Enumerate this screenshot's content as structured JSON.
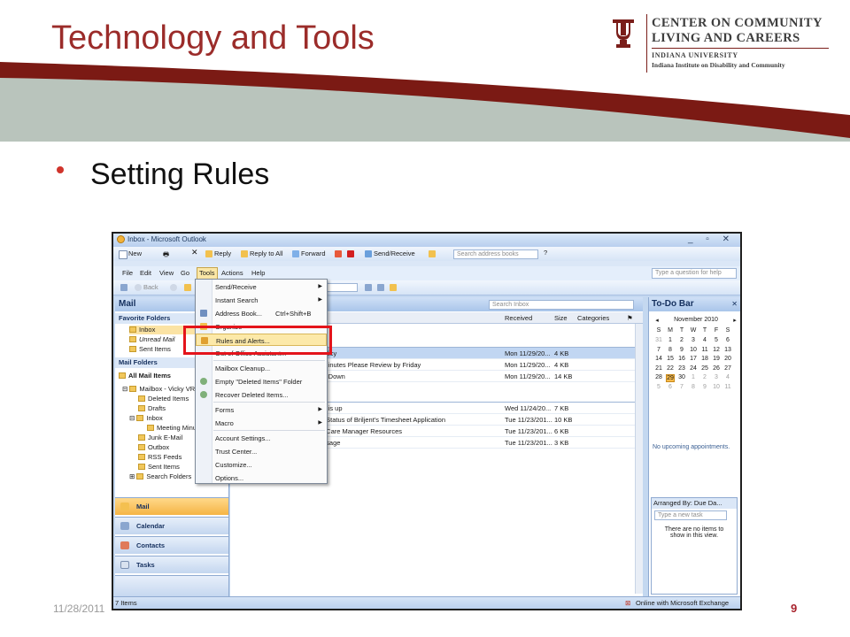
{
  "slide": {
    "title": "Technology and Tools",
    "bullet": "Setting Rules",
    "date": "11/28/2011",
    "page": "9"
  },
  "brand": {
    "line1": "CENTER ON COMMUNITY",
    "line2": "LIVING AND CAREERS",
    "line3": "INDIANA UNIVERSITY",
    "line4": "Indiana Institute on Disability and Community"
  },
  "colors": {
    "brand_red": "#7a1e1a",
    "title_red": "#9b2c2a",
    "swoosh_gray": "#b9c4bc",
    "highlight": "#e4141b"
  },
  "outlook": {
    "title": "Inbox - Microsoft Outlook",
    "toolbar1": {
      "new": "New",
      "reply": "Reply",
      "reply_all": "Reply to All",
      "forward": "Forward",
      "send_receive": "Send/Receive",
      "search_placeholder": "Search address books"
    },
    "menubar": [
      "File",
      "Edit",
      "View",
      "Go",
      "Tools",
      "Actions",
      "Help"
    ],
    "help_placeholder": "Type a question for help",
    "toolbar2": {
      "back": "Back"
    },
    "nav": {
      "header": "Mail",
      "favorites_header": "Favorite Folders",
      "favorites": [
        "Inbox",
        "Unread Mail",
        "Sent Items"
      ],
      "mail_folders_header": "Mail Folders",
      "all_mail": "All Mail Items",
      "mailbox": "Mailbox - Vicky VR",
      "folders": [
        "Deleted Items",
        "Drafts",
        "Inbox",
        "Meeting Minu",
        "Junk E-Mail",
        "Outbox",
        "RSS Feeds",
        "Sent Items",
        "Search Folders"
      ],
      "buttons": [
        "Mail",
        "Calendar",
        "Contacts",
        "Tasks"
      ]
    },
    "list": {
      "search_placeholder": "Search Inbox",
      "columns": [
        "ct",
        "Received",
        "Size",
        "Categories"
      ],
      "rows": [
        {
          "subject": "n Policy",
          "received": "Mon 11/29/20...",
          "size": "4 KB"
        },
        {
          "subject": "ng Minutes Please Review by Friday",
          "received": "Mon 11/29/20...",
          "size": "4 KB"
        },
        {
          "subject": "heet Down",
          "received": "Mon 11/29/20...",
          "size": "14 KB"
        },
        {
          "subject": "heet is up",
          "received": "Wed 11/24/20...",
          "size": "7 KB"
        },
        {
          "subject": "ion: Status of Briljent's Timesheet Application",
          "received": "Tue 11/23/201...",
          "size": "10 KB"
        },
        {
          "subject": "alth Care Manager Resources",
          "received": "Tue 11/23/201...",
          "size": "6 KB"
        },
        {
          "subject": "message",
          "received": "Tue 11/23/201...",
          "size": "3 KB"
        }
      ]
    },
    "todo": {
      "header": "To-Do Bar",
      "month": "November 2010",
      "weekdays": [
        "S",
        "M",
        "T",
        "W",
        "T",
        "F",
        "S"
      ],
      "weeks": [
        [
          "31",
          "1",
          "2",
          "3",
          "4",
          "5",
          "6"
        ],
        [
          "7",
          "8",
          "9",
          "10",
          "11",
          "12",
          "13"
        ],
        [
          "14",
          "15",
          "16",
          "17",
          "18",
          "19",
          "20"
        ],
        [
          "21",
          "22",
          "23",
          "24",
          "25",
          "26",
          "27"
        ],
        [
          "28",
          "29",
          "30",
          "1",
          "2",
          "3",
          "4"
        ],
        [
          "5",
          "6",
          "7",
          "8",
          "9",
          "10",
          "11"
        ]
      ],
      "no_appointments": "No upcoming appointments.",
      "arranged_by": "Arranged By: Due Da...",
      "new_task_placeholder": "Type a new task",
      "empty_text": "There are no items to show in this view."
    },
    "status": {
      "items": "7 Items",
      "connection": "Online with Microsoft Exchange"
    },
    "tools_menu": [
      {
        "label": "Send/Receive",
        "submenu": true
      },
      {
        "label": "Instant Search",
        "submenu": true
      },
      {
        "label": "Address Book...",
        "shortcut": "Ctrl+Shift+B"
      },
      {
        "label": "Organize"
      },
      {
        "label": "Rules and Alerts..."
      },
      {
        "label": "Out of Office Assistant..."
      },
      {
        "label": "Mailbox Cleanup..."
      },
      {
        "label": "Empty \"Deleted Items\" Folder"
      },
      {
        "label": "Recover Deleted Items..."
      },
      {
        "label": "Forms",
        "submenu": true
      },
      {
        "label": "Macro",
        "submenu": true
      },
      {
        "label": "Account Settings..."
      },
      {
        "label": "Trust Center..."
      },
      {
        "label": "Customize..."
      },
      {
        "label": "Options..."
      }
    ]
  }
}
